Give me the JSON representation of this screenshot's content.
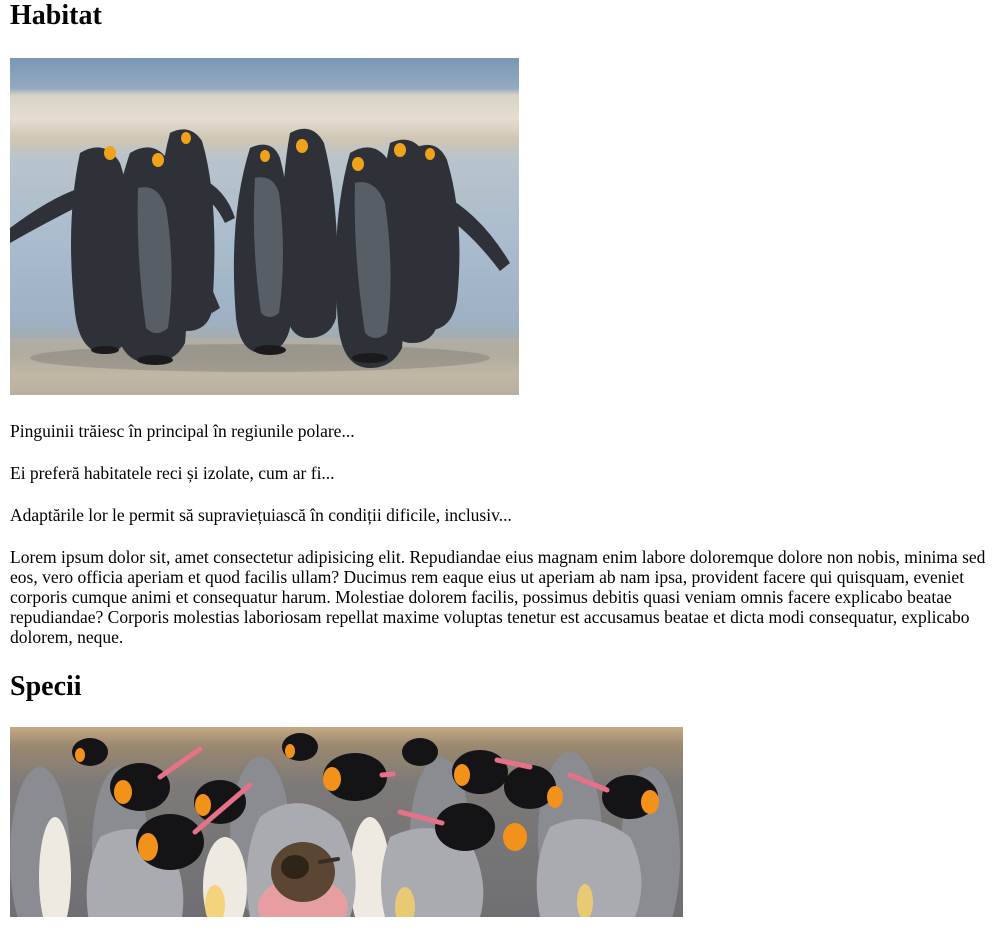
{
  "sections": [
    {
      "title": "Habitat",
      "image": {
        "alt": "Pinguini"
      },
      "paragraphs": [
        "Pinguinii trăiesc în principal în regiunile polare...",
        "Ei preferă habitatele reci și izolate, cum ar fi...",
        "Adaptările lor le permit să supraviețuiască în condiții dificile, inclusiv...",
        "Lorem ipsum dolor sit, amet consectetur adipisicing elit. Repudiandae eius magnam enim labore doloremque dolore non nobis, minima sed eos, vero officia aperiam et quod facilis ullam? Ducimus rem eaque eius ut aperiam ab nam ipsa, provident facere qui quisquam, eveniet corporis cumque animi et consequatur harum. Molestiae dolorem facilis, possimus debitis quasi veniam omnis facere explicabo beatae repudiandae? Corporis molestias laboriosam repellat maxime voluptas tenetur est accusamus beatae et dicta modi consequatur, explicabo dolorem, neque."
      ]
    },
    {
      "title": "Specii",
      "image": {
        "alt": "Pinguini imperiali"
      }
    }
  ],
  "colors": {
    "text": "#000000",
    "background": "#ffffff"
  }
}
